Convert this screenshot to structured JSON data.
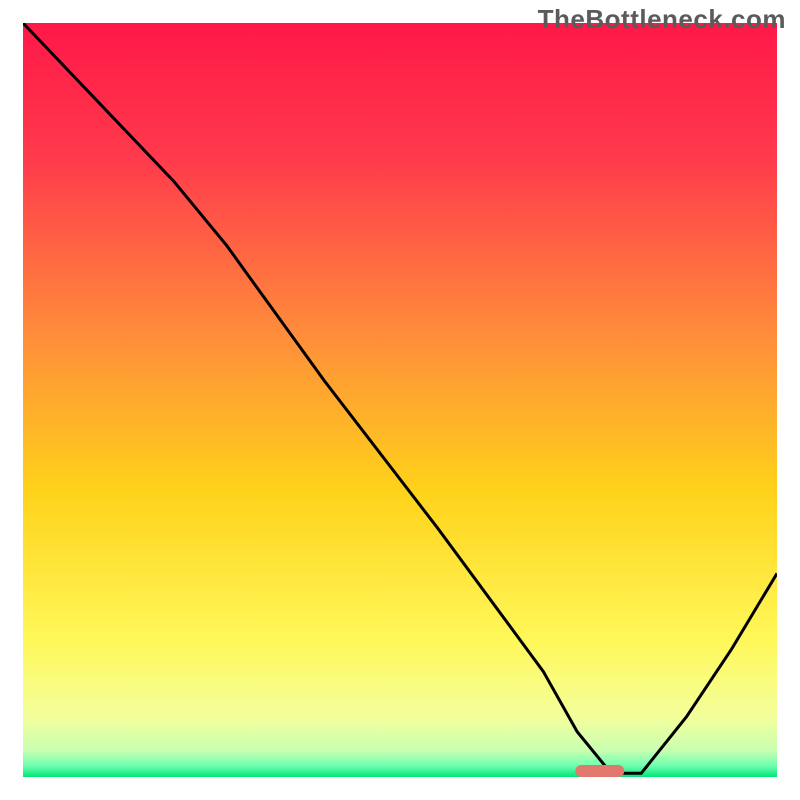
{
  "watermark": "TheBottleneck.com",
  "chart_data": {
    "type": "line",
    "title": "",
    "xlabel": "",
    "ylabel": "",
    "xlim": [
      0,
      100
    ],
    "ylim": [
      0,
      100
    ],
    "grid": false,
    "legend": false,
    "colors": {
      "gradient_top": "#ff1a4d",
      "gradient_mid": "#ffd400",
      "gradient_low": "#f9ff9a",
      "gradient_bottom": "#00e676",
      "curve": "#000000",
      "marker": "#e0786e"
    },
    "series": [
      {
        "name": "curve",
        "x": [
          0,
          10,
          20,
          27,
          40,
          55,
          69,
          73.5,
          78,
          82,
          88,
          94,
          100
        ],
        "y": [
          100,
          89.5,
          79,
          70.5,
          52.5,
          33,
          14,
          6,
          0.5,
          0.5,
          8,
          17,
          27
        ]
      }
    ],
    "marker": {
      "x_center": 76.5,
      "y_center": 0.8,
      "width": 6.5,
      "height": 1.6
    },
    "background_gradient_stops": [
      {
        "offset": 0.0,
        "color": "#ff1848"
      },
      {
        "offset": 0.18,
        "color": "#ff3a4c"
      },
      {
        "offset": 0.42,
        "color": "#ff8f3a"
      },
      {
        "offset": 0.62,
        "color": "#ffd21a"
      },
      {
        "offset": 0.82,
        "color": "#fff85a"
      },
      {
        "offset": 0.92,
        "color": "#f4ff9c"
      },
      {
        "offset": 0.965,
        "color": "#c8ffb0"
      },
      {
        "offset": 0.985,
        "color": "#6fffb0"
      },
      {
        "offset": 1.0,
        "color": "#00e676"
      }
    ]
  }
}
